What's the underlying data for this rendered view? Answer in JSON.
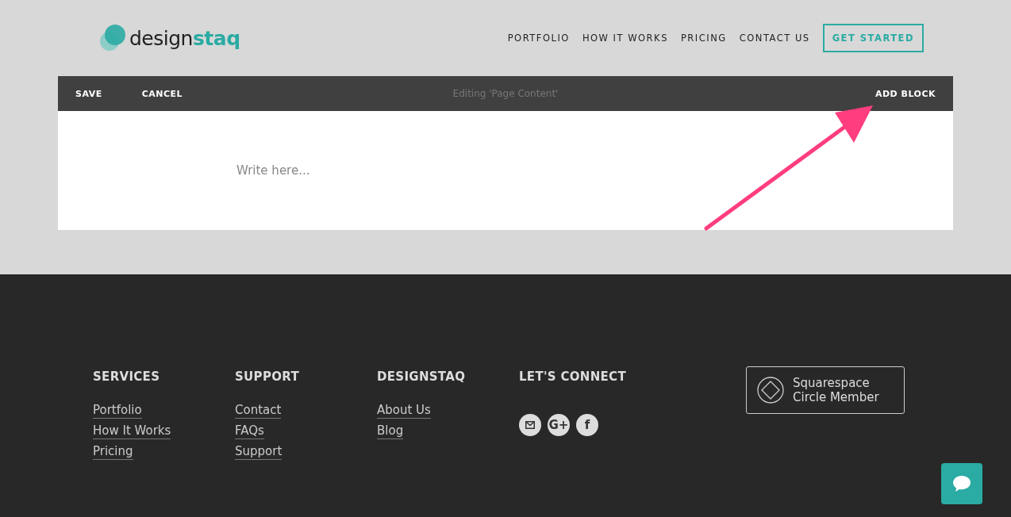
{
  "header": {
    "logo": {
      "part_1": "design",
      "part_2": "staq"
    },
    "nav": [
      "PORTFOLIO",
      "HOW IT WORKS",
      "PRICING",
      "CONTACT US"
    ],
    "cta": "GET STARTED"
  },
  "editor": {
    "buttons": [
      "SAVE",
      "CANCEL"
    ],
    "title": "Editing 'Page Content'",
    "add_block": "ADD BLOCK",
    "placeholder": "Write here..."
  },
  "footer": {
    "columns": [
      {
        "heading": "SERVICES",
        "links": [
          "Portfolio",
          "How It Works",
          "Pricing"
        ]
      },
      {
        "heading": "SUPPORT",
        "links": [
          "Contact",
          "FAQs",
          "Support"
        ]
      },
      {
        "heading": "DESIGNSTAQ",
        "links": [
          "About Us",
          "Blog"
        ]
      },
      {
        "heading": "LET'S CONNECT",
        "social": [
          {
            "kind": "mail"
          },
          {
            "kind": "text",
            "label": "G+"
          },
          {
            "kind": "text",
            "label": "f"
          }
        ]
      }
    ],
    "badge": [
      "Squarespace",
      "Circle Member"
    ]
  }
}
